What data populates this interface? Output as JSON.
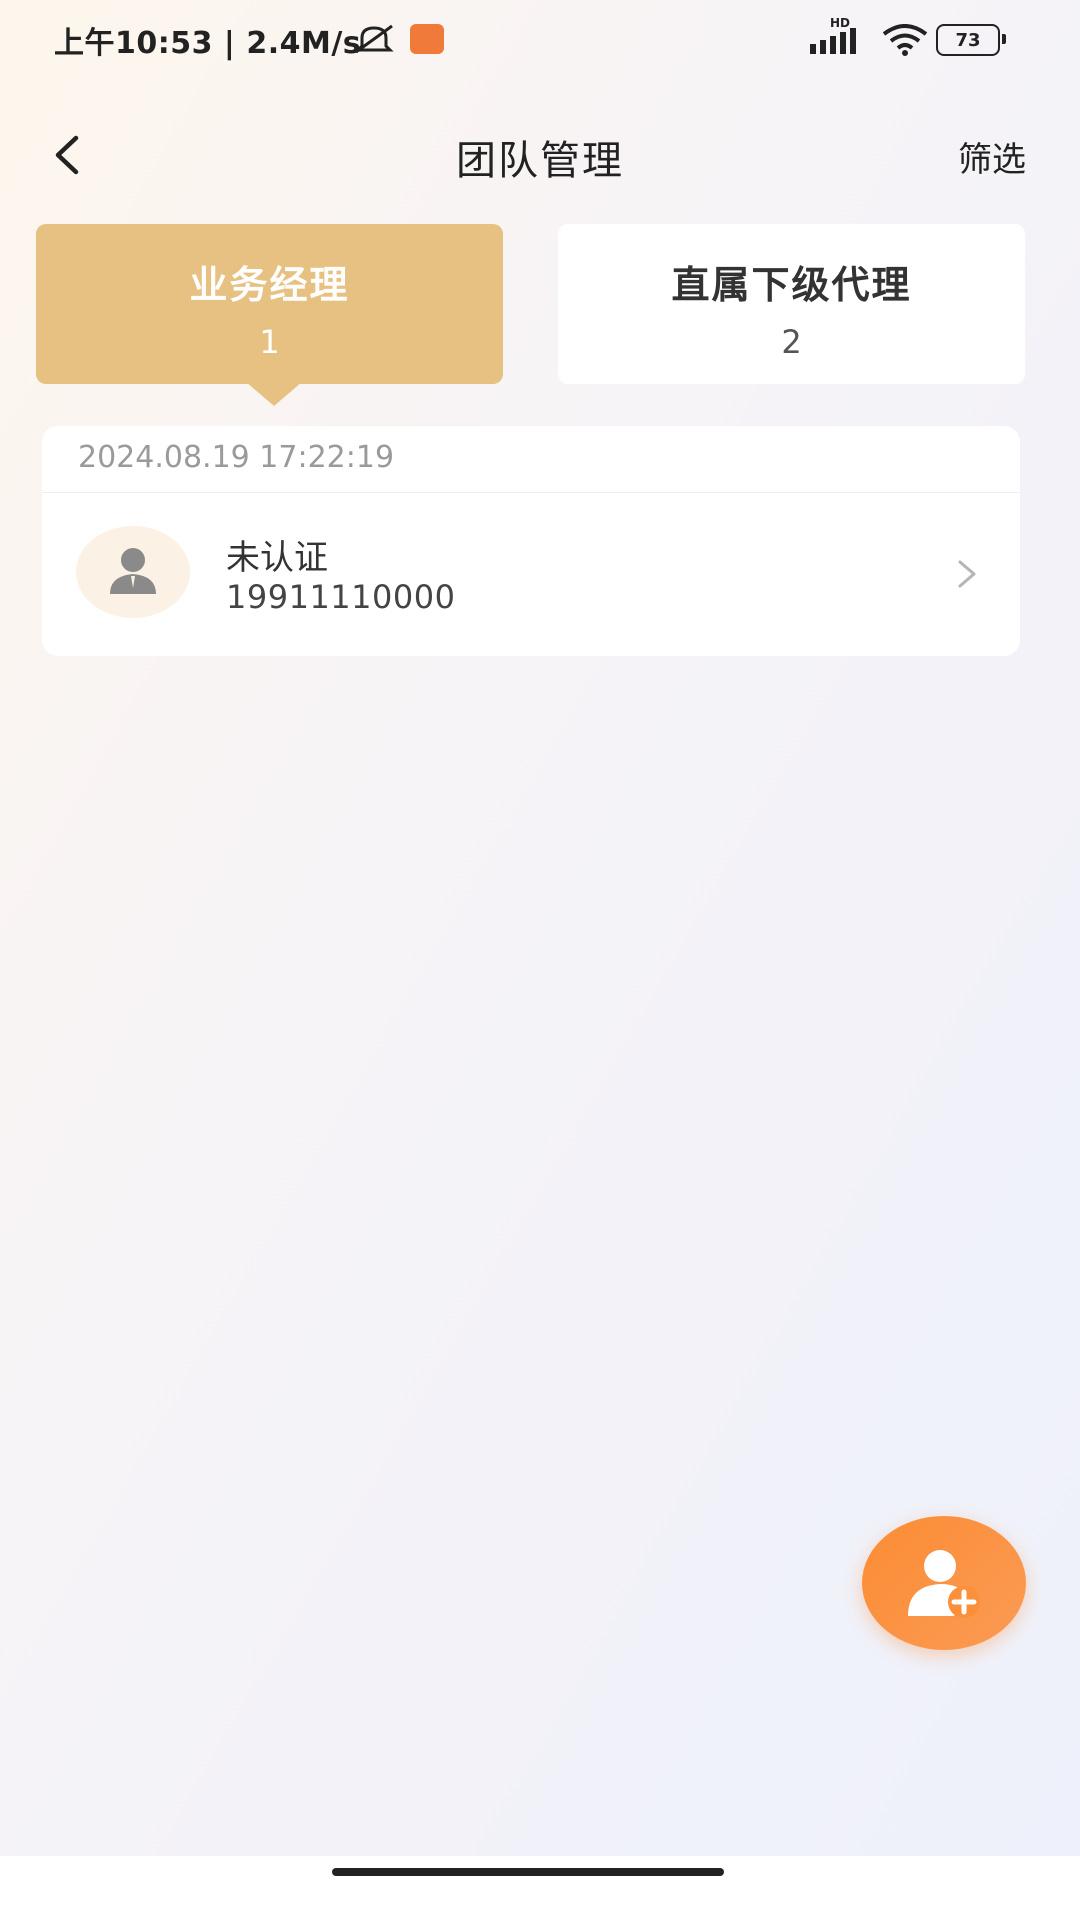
{
  "status_bar": {
    "time": "上午10:53 | 2.4M/s",
    "network_badge": "HD",
    "battery": "73",
    "icons": [
      "mute-icon",
      "app-notification-icon",
      "signal-icon",
      "wifi-icon",
      "battery-icon"
    ]
  },
  "header": {
    "title": "团队管理",
    "filter_label": "筛选",
    "back_icon": "chevron-left-icon"
  },
  "tabs": [
    {
      "label": "业务经理",
      "count": "1",
      "active": true
    },
    {
      "label": "直属下级代理",
      "count": "2",
      "active": false
    }
  ],
  "list": {
    "items": [
      {
        "date": "2024.08.19 17:22:19",
        "name": "未认证",
        "phone": "19911110000",
        "avatar_icon": "person-icon"
      }
    ]
  },
  "fab": {
    "icon": "add-user-icon"
  },
  "colors": {
    "accent_tab": "#e6c182",
    "fab": "#fb8c34",
    "date_text": "#9a9a9a"
  }
}
